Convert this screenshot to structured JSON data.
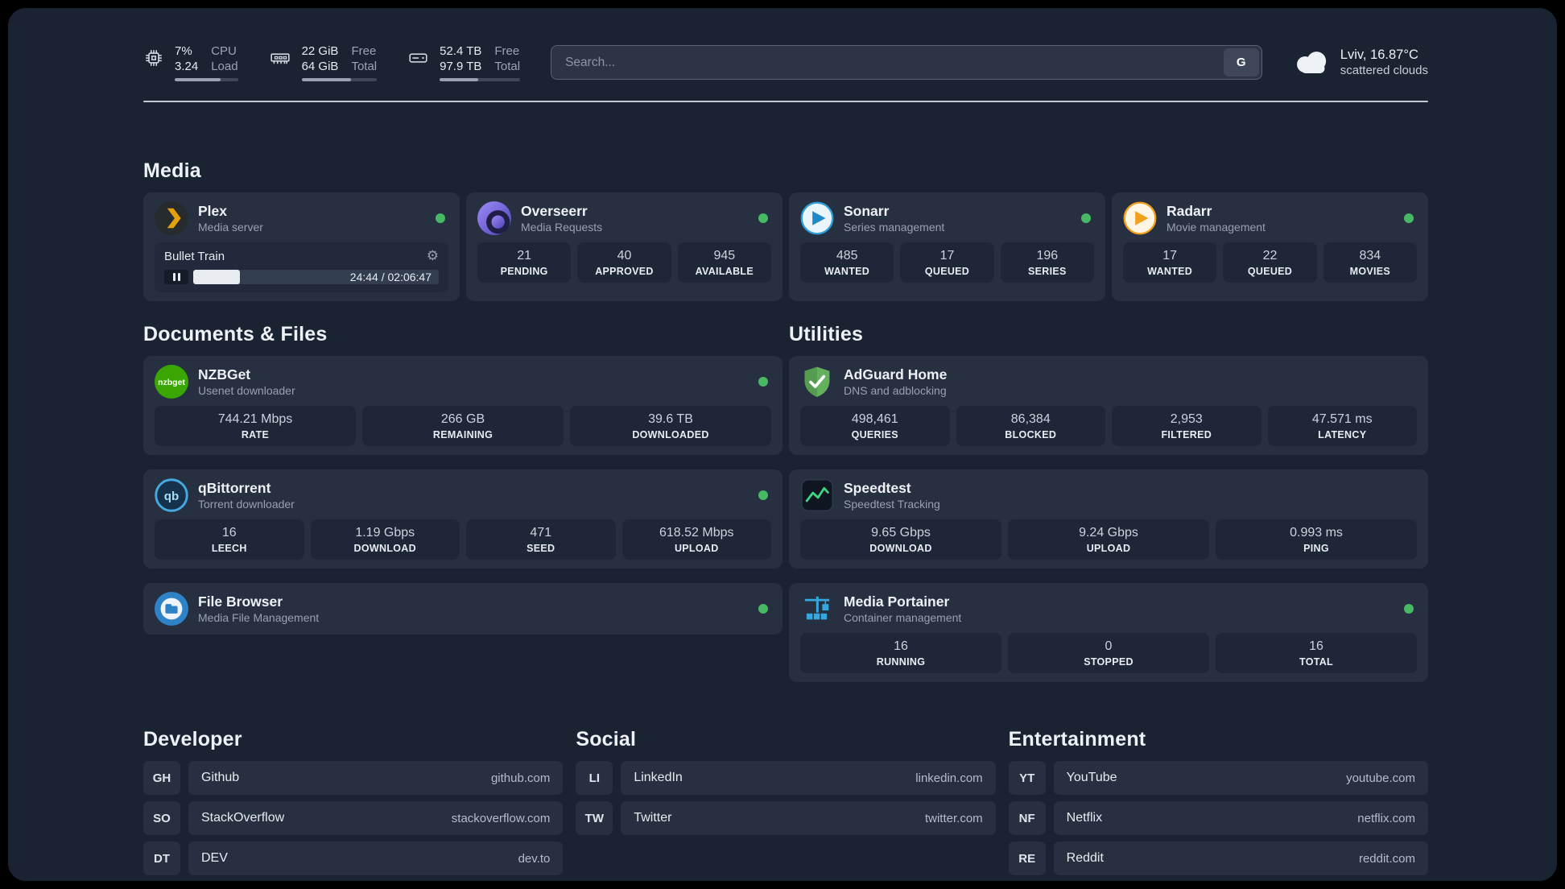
{
  "colors": {
    "status_green": "#47b863",
    "plex_orange": "#e5a00d",
    "adguard_green": "#63b15c",
    "speedtest_green": "#3fd684",
    "portainer_blue": "#35a6de",
    "nzbget_green": "#3aa604"
  },
  "topbar": {
    "cpu": {
      "value1": "7%",
      "value2": "3.24",
      "label1": "CPU",
      "label2": "Load",
      "progress": 72
    },
    "ram": {
      "value1": "22 GiB",
      "value2": "64 GiB",
      "label1": "Free",
      "label2": "Total",
      "progress": 66
    },
    "disk": {
      "value1": "52.4 TB",
      "value2": "97.9 TB",
      "label1": "Free",
      "label2": "Total",
      "progress": 48
    },
    "search": {
      "placeholder": "Search...",
      "button_label": "G"
    },
    "weather": {
      "location": "Lviv, 16.87°C",
      "condition": "scattered clouds"
    }
  },
  "media": {
    "title": "Media",
    "plex": {
      "app": "Plex",
      "subtitle": "Media server",
      "now_playing": "Bullet Train",
      "time": "24:44 / 02:06:47",
      "progress": 19
    },
    "overseerr": {
      "app": "Overseerr",
      "subtitle": "Media Requests",
      "stats": [
        {
          "value": "21",
          "label": "PENDING"
        },
        {
          "value": "40",
          "label": "APPROVED"
        },
        {
          "value": "945",
          "label": "AVAILABLE"
        }
      ]
    },
    "sonarr": {
      "app": "Sonarr",
      "subtitle": "Series management",
      "stats": [
        {
          "value": "485",
          "label": "WANTED"
        },
        {
          "value": "17",
          "label": "QUEUED"
        },
        {
          "value": "196",
          "label": "SERIES"
        }
      ]
    },
    "radarr": {
      "app": "Radarr",
      "subtitle": "Movie management",
      "stats": [
        {
          "value": "17",
          "label": "WANTED"
        },
        {
          "value": "22",
          "label": "QUEUED"
        },
        {
          "value": "834",
          "label": "MOVIES"
        }
      ]
    }
  },
  "documents": {
    "title": "Documents & Files",
    "nzbget": {
      "app": "NZBGet",
      "subtitle": "Usenet downloader",
      "stats": [
        {
          "value": "744.21 Mbps",
          "label": "RATE"
        },
        {
          "value": "266 GB",
          "label": "REMAINING"
        },
        {
          "value": "39.6 TB",
          "label": "DOWNLOADED"
        }
      ]
    },
    "qbittorrent": {
      "app": "qBittorrent",
      "subtitle": "Torrent downloader",
      "stats": [
        {
          "value": "16",
          "label": "LEECH"
        },
        {
          "value": "1.19 Gbps",
          "label": "DOWNLOAD"
        },
        {
          "value": "471",
          "label": "SEED"
        },
        {
          "value": "618.52 Mbps",
          "label": "UPLOAD"
        }
      ]
    },
    "filebrowser": {
      "app": "File Browser",
      "subtitle": "Media File Management"
    }
  },
  "utilities": {
    "title": "Utilities",
    "adguard": {
      "app": "AdGuard Home",
      "subtitle": "DNS and adblocking",
      "stats": [
        {
          "value": "498,461",
          "label": "QUERIES"
        },
        {
          "value": "86,384",
          "label": "BLOCKED"
        },
        {
          "value": "2,953",
          "label": "FILTERED"
        },
        {
          "value": "47.571 ms",
          "label": "LATENCY"
        }
      ]
    },
    "speedtest": {
      "app": "Speedtest",
      "subtitle": "Speedtest Tracking",
      "stats": [
        {
          "value": "9.65 Gbps",
          "label": "DOWNLOAD"
        },
        {
          "value": "9.24 Gbps",
          "label": "UPLOAD"
        },
        {
          "value": "0.993 ms",
          "label": "PING"
        }
      ]
    },
    "portainer": {
      "app": "Media Portainer",
      "subtitle": "Container management",
      "stats": [
        {
          "value": "16",
          "label": "RUNNING"
        },
        {
          "value": "0",
          "label": "STOPPED"
        },
        {
          "value": "16",
          "label": "TOTAL"
        }
      ]
    }
  },
  "bookmarks": {
    "developer": {
      "title": "Developer",
      "items": [
        {
          "abbr": "GH",
          "name": "Github",
          "domain": "github.com"
        },
        {
          "abbr": "SO",
          "name": "StackOverflow",
          "domain": "stackoverflow.com"
        },
        {
          "abbr": "DT",
          "name": "DEV",
          "domain": "dev.to"
        }
      ]
    },
    "social": {
      "title": "Social",
      "items": [
        {
          "abbr": "LI",
          "name": "LinkedIn",
          "domain": "linkedin.com"
        },
        {
          "abbr": "TW",
          "name": "Twitter",
          "domain": "twitter.com"
        }
      ]
    },
    "entertainment": {
      "title": "Entertainment",
      "items": [
        {
          "abbr": "YT",
          "name": "YouTube",
          "domain": "youtube.com"
        },
        {
          "abbr": "NF",
          "name": "Netflix",
          "domain": "netflix.com"
        },
        {
          "abbr": "RE",
          "name": "Reddit",
          "domain": "reddit.com"
        }
      ]
    }
  }
}
